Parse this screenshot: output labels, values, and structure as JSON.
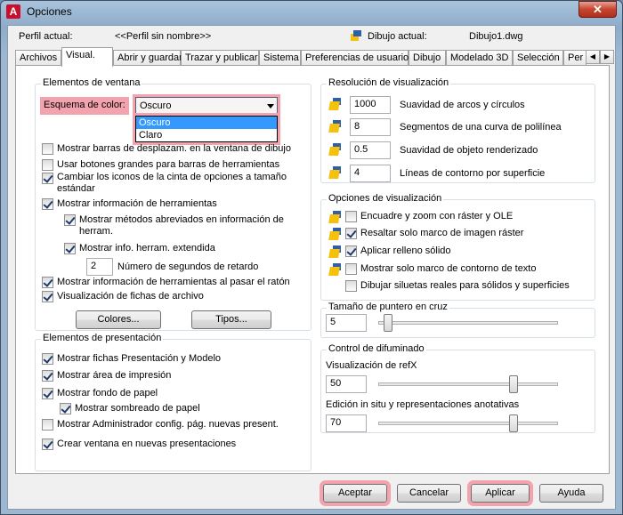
{
  "window": {
    "title": "Opciones",
    "close": "✕"
  },
  "profile": {
    "label": "Perfil actual:",
    "value": "<<Perfil sin nombre>>",
    "drawing_label": "Dibujo actual:",
    "drawing_value": "Dibujo1.dwg"
  },
  "tabs": [
    "Archivos",
    "Visual.",
    "Abrir y guardar",
    "Trazar y publicar",
    "Sistema",
    "Preferencias de usuario",
    "Dibujo",
    "Modelado 3D",
    "Selección",
    "Per"
  ],
  "active_tab": "Visual.",
  "window_elements": {
    "title": "Elementos de ventana",
    "color_scheme_label": "Esquema de color:",
    "color_scheme_value": "Oscuro",
    "color_scheme_options": [
      "Oscuro",
      "Claro"
    ],
    "checkboxes": [
      {
        "label": "Mostrar barras de desplazam. en la ventana de dibujo",
        "visible_label": "Mostrar barras de desplazam. en la ventana de dibujo",
        "checked": false
      },
      {
        "label": "Usar botones grandes para barras de herramientas",
        "checked": false
      },
      {
        "label": "Cambiar los iconos de la cinta de opciones a tamaño",
        "label2": "estándar",
        "checked": true
      },
      {
        "label": "Mostrar información de herramientas",
        "checked": true
      },
      {
        "label": "Mostrar métodos abreviados en información de",
        "label2": "herram.",
        "checked": true
      },
      {
        "label": "Mostrar info. herram. extendida",
        "checked": true
      },
      {
        "label": "Mostrar información de herramientas al pasar el ratón",
        "checked": true
      },
      {
        "label": "Visualización de fichas de archivo",
        "checked": true
      }
    ],
    "delay_value": "2",
    "delay_label": "Número de segundos de retardo",
    "colors_button": "Colores...",
    "fonts_button": "Tipos..."
  },
  "layout_elements": {
    "title": "Elementos de presentación",
    "checkboxes": [
      {
        "label": "Mostrar fichas Presentación y Modelo",
        "checked": true
      },
      {
        "label": "Mostrar área de impresión",
        "checked": true
      },
      {
        "label": "Mostrar fondo de papel",
        "checked": true
      },
      {
        "label": "Mostrar sombreado de papel",
        "checked": true
      },
      {
        "label": "Mostrar Administrador config. pág. nuevas present.",
        "checked": false
      },
      {
        "label": "Crear ventana en nuevas presentaciones",
        "checked": true
      }
    ]
  },
  "display_resolution": {
    "title": "Resolución de visualización",
    "rows": [
      {
        "value": "1000",
        "label": "Suavidad de arcos y círculos"
      },
      {
        "value": "8",
        "label": "Segmentos de una curva de polilínea"
      },
      {
        "value": "0.5",
        "label": "Suavidad de objeto renderizado"
      },
      {
        "value": "4",
        "label": "Líneas de contorno por superficie"
      }
    ]
  },
  "display_performance": {
    "title": "Opciones de visualización",
    "checkboxes": [
      {
        "label": "Encuadre y zoom con ráster y OLE",
        "checked": false,
        "icon": true
      },
      {
        "label": "Resaltar solo marco de imagen ráster",
        "checked": true,
        "icon": true
      },
      {
        "label": "Aplicar relleno sólido",
        "checked": true,
        "icon": true
      },
      {
        "label": "Mostrar solo marco de contorno de texto",
        "checked": false,
        "icon": true
      },
      {
        "label": "Dibujar siluetas reales para sólidos y superficies",
        "checked": false,
        "icon": false
      }
    ]
  },
  "crosshair": {
    "title": "Tamaño de puntero en cruz",
    "value": "5",
    "level": 0.05
  },
  "fade_control": {
    "title": "Control de difuminado",
    "xref_label": "Visualización de refX",
    "xref_value": "50",
    "xref_level": 0.5,
    "inplace_label": "Edición in situ y representaciones anotativas",
    "inplace_value": "70",
    "inplace_level": 0.7
  },
  "buttons": {
    "ok": "Aceptar",
    "cancel": "Cancelar",
    "apply": "Aplicar",
    "help": "Ayuda"
  }
}
